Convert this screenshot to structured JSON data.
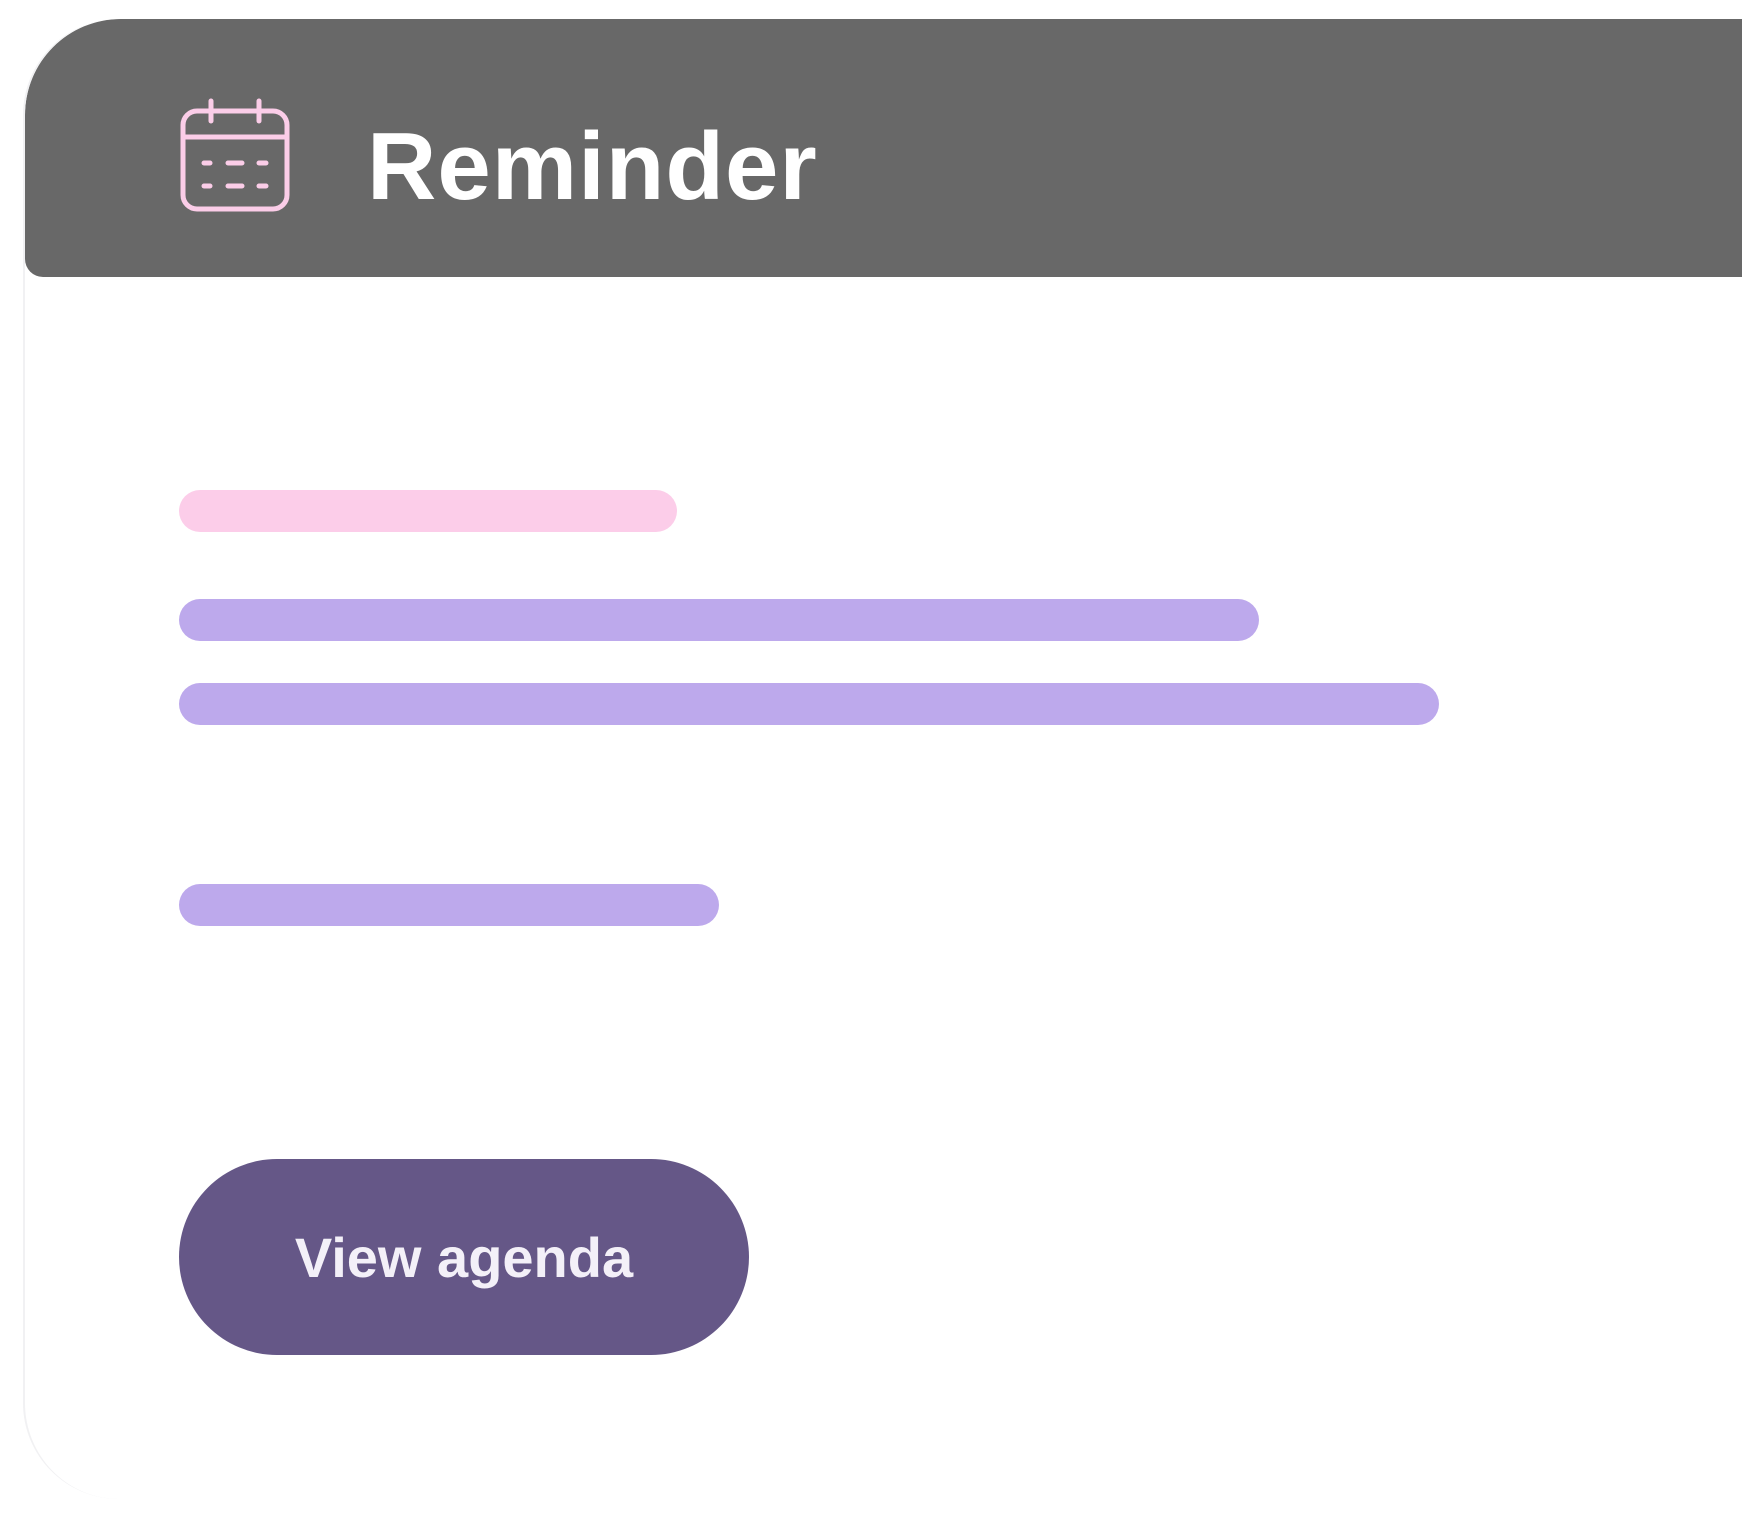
{
  "header": {
    "title": "Reminder",
    "icon": "calendar-icon",
    "background_color": "#686868",
    "icon_color": "#fbcde8"
  },
  "content": {
    "placeholder_lines": [
      {
        "role": "subtitle-placeholder",
        "color": "#fccde9"
      },
      {
        "role": "text-placeholder",
        "color": "#bda9ec"
      },
      {
        "role": "text-placeholder",
        "color": "#bda9ec"
      },
      {
        "role": "text-placeholder",
        "color": "#bda9ec"
      }
    ]
  },
  "actions": {
    "view_agenda_label": "View agenda",
    "button_color": "#655787"
  }
}
